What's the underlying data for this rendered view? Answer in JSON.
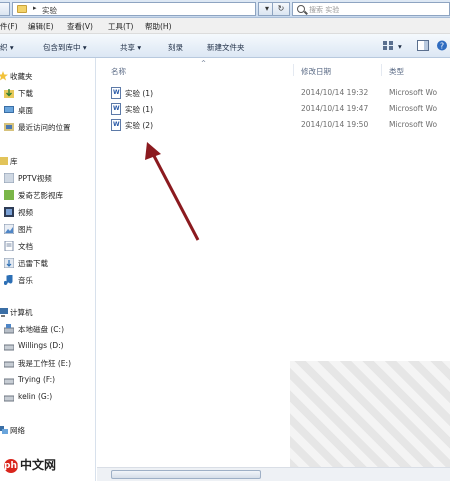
{
  "addressbar": {
    "arrow": "▸",
    "path": "实验",
    "search_placeholder": "搜索 实验"
  },
  "menubar": [
    {
      "label": "件(F)"
    },
    {
      "label": "编辑(E)"
    },
    {
      "label": "查看(V)"
    },
    {
      "label": "工具(T)"
    },
    {
      "label": "帮助(H)"
    }
  ],
  "toolbar": {
    "organize": "织 ▾",
    "include_in_library": "包含到库中 ▾",
    "share": "共享 ▾",
    "burn": "刻录",
    "new_folder": "新建文件夹"
  },
  "sidebar": {
    "favorites": "收藏夹",
    "downloads": "下载",
    "desktop": "桌面",
    "recent": "最近访问的位置",
    "libraries": "库",
    "pptv": "PPTV视频",
    "iqiyi": "爱奇艺影视库",
    "videos": "视频",
    "pictures": "图片",
    "documents": "文档",
    "xunlei": "迅雷下载",
    "music": "音乐",
    "computer": "计算机",
    "drive_c": "本地磁盘 (C:)",
    "drive_d": "Willings (D:)",
    "drive_e": "我是工作狂 (E:)",
    "drive_f": "Trying (F:)",
    "drive_g": "kelin (G:)",
    "network": "网络"
  },
  "columns": {
    "name": "名称",
    "modified": "修改日期",
    "type": "类型"
  },
  "files": [
    {
      "name": "实验 (1)",
      "date": "2014/10/14 19:32",
      "type": "Microsoft Wo"
    },
    {
      "name": "实验 (1)",
      "date": "2014/10/14 19:47",
      "type": "Microsoft Wo"
    },
    {
      "name": "实验 (2)",
      "date": "2014/10/14 19:50",
      "type": "Microsoft Wo"
    }
  ],
  "watermark": "中文网",
  "colors": {
    "arrow": "#8b1a1f",
    "accent": "#3a6ea5"
  }
}
